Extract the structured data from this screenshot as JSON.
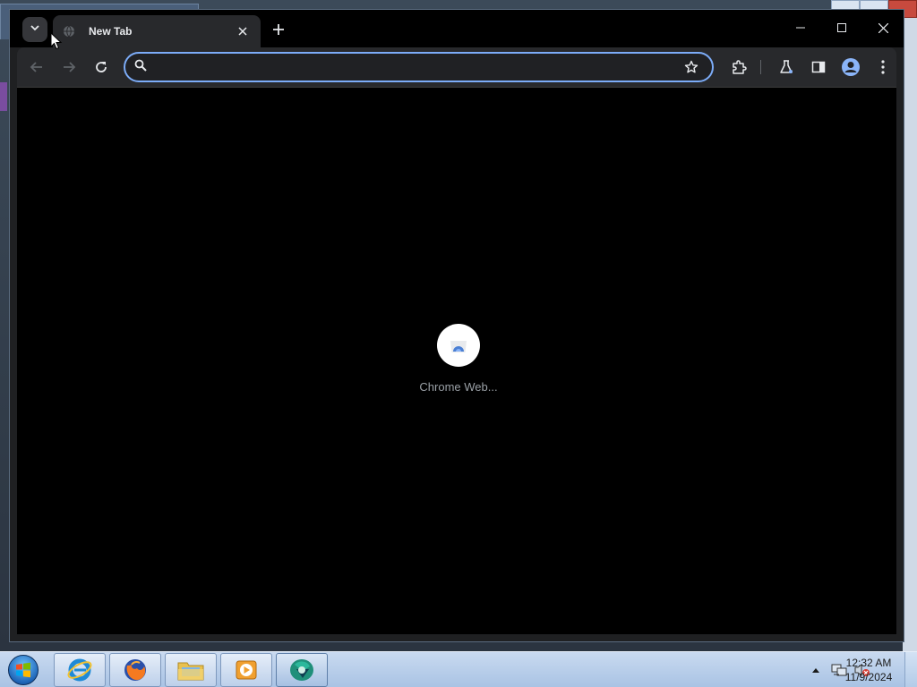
{
  "browser": {
    "tab": {
      "title": "New Tab"
    },
    "omnibox": {
      "value": "",
      "placeholder": ""
    },
    "content": {
      "loading_label": "Chrome Web..."
    },
    "accent_color": "#7cacf8"
  },
  "icons": {
    "tab_search": "chevron-down-icon",
    "favicon": "globe-icon",
    "tab_close": "close-icon",
    "new_tab": "plus-icon",
    "back": "arrow-left-icon",
    "forward": "arrow-right-icon",
    "reload": "reload-icon",
    "search": "search-icon",
    "bookmark": "star-icon",
    "extensions": "puzzle-icon",
    "labs": "flask-icon",
    "side_panel": "side-panel-icon",
    "profile": "profile-icon",
    "menu": "kebab-menu-icon"
  },
  "taskbar": {
    "apps": [
      {
        "name": "Internet Explorer",
        "icon": "internet-explorer-icon"
      },
      {
        "name": "Firefox",
        "icon": "firefox-icon"
      },
      {
        "name": "Windows Explorer",
        "icon": "folder-icon"
      },
      {
        "name": "Media Player",
        "icon": "media-player-icon"
      },
      {
        "name": "Chrome",
        "icon": "chrome-icon"
      }
    ],
    "clock": {
      "time": "12:32 AM",
      "date": "11/9/2024"
    }
  }
}
